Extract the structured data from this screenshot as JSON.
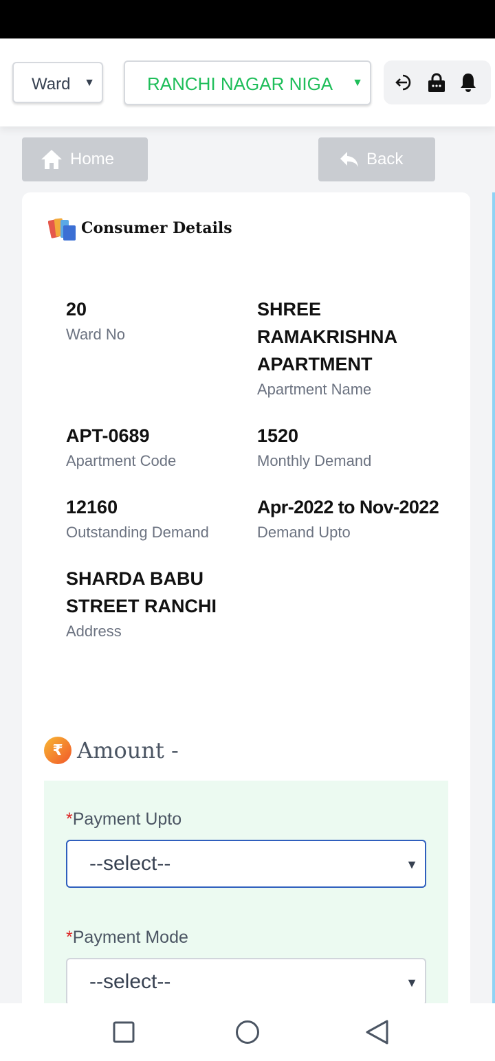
{
  "header": {
    "ward_select": "Ward",
    "ulb_select": "RANCHI NAGAR NIGAM",
    "icons": [
      "logout-icon",
      "lock-icon",
      "bell-icon"
    ]
  },
  "nav": {
    "home_label": "Home",
    "back_label": "Back"
  },
  "consumer": {
    "title": "Consumer Details",
    "fields": {
      "ward_no": {
        "value": "20",
        "label": "Ward No"
      },
      "apartment_name": {
        "value": "SHREE RAMAKRISHNA APARTMENT",
        "label": "Apartment Name"
      },
      "apartment_code": {
        "value": "APT-0689",
        "label": "Apartment Code"
      },
      "monthly_demand": {
        "value": "1520",
        "label": "Monthly Demand"
      },
      "outstanding_demand": {
        "value": "12160",
        "label": "Outstanding Demand"
      },
      "demand_upto": {
        "value": "Apr-2022 to Nov-2022",
        "label": "Demand Upto"
      },
      "address": {
        "value": "SHARDA BABU STREET RANCHI",
        "label": "Address"
      }
    }
  },
  "amount": {
    "title": "Amount -",
    "rupee_symbol": "₹",
    "required_mark": "*",
    "payment_upto": {
      "label": "Payment Upto",
      "value": "--select--"
    },
    "payment_mode": {
      "label": "Payment Mode",
      "value": "--select--"
    }
  },
  "colors": {
    "accent_green": "#1fbe5a",
    "panel_bg": "#ecfaf1",
    "focus_border": "#2f5fbd",
    "required": "#dc2626"
  }
}
